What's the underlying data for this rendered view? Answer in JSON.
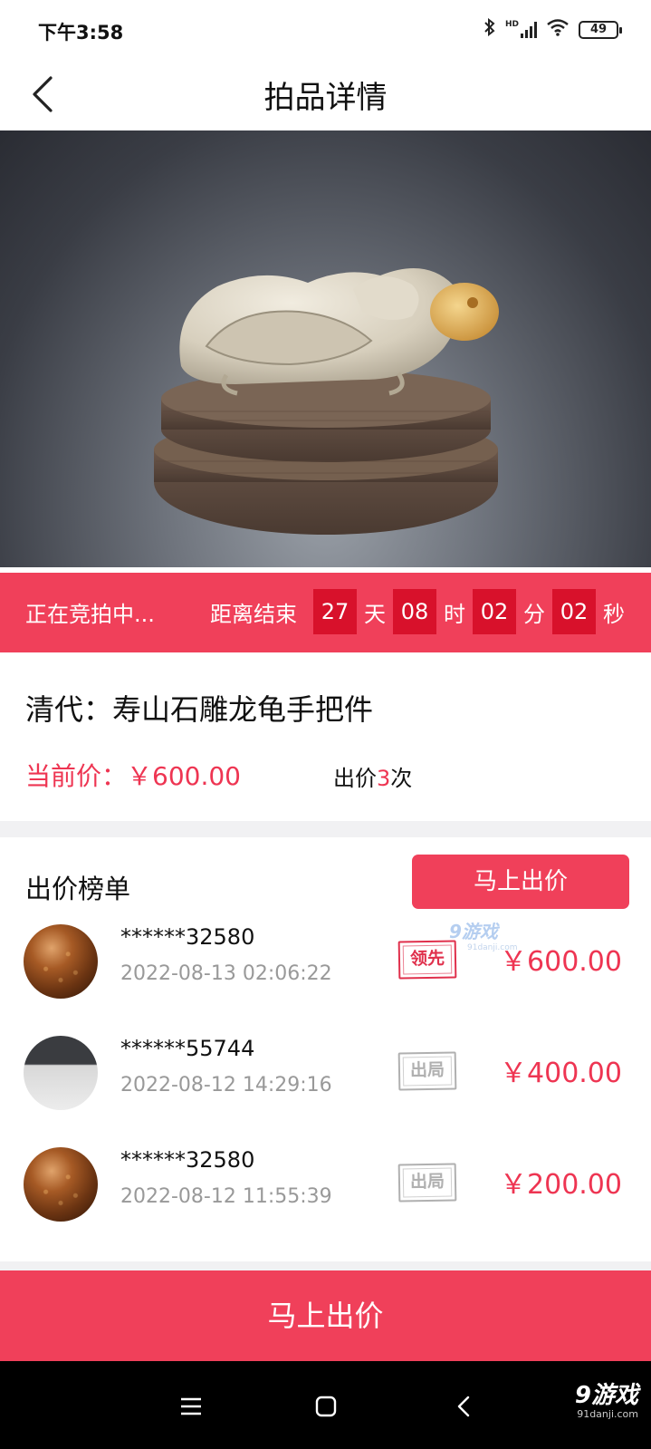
{
  "status_bar": {
    "time": "下午3:58",
    "hd_label": "HD",
    "battery": "49"
  },
  "nav": {
    "title": "拍品详情"
  },
  "carousel": {
    "dots": 4,
    "active_index": 0
  },
  "auction": {
    "status": "正在竞拍中...",
    "countdown_label": "距离结束",
    "days": "27",
    "days_unit": "天",
    "hours": "08",
    "hours_unit": "时",
    "minutes": "02",
    "minutes_unit": "分",
    "seconds": "02",
    "seconds_unit": "秒"
  },
  "lot": {
    "title": "清代：寿山石雕龙龟手把件",
    "current_price": "当前价：￥600.00",
    "bid_count_prefix": "出价",
    "bid_count": "3",
    "bid_count_suffix": "次"
  },
  "leaderboard": {
    "title": "出价榜单",
    "bid_button": "马上出价",
    "watermark": "9游戏",
    "watermark_url": "91danji.com",
    "rows": [
      {
        "bidder": "******32580",
        "time": "2022-08-13 02:06:22",
        "badge": "领先",
        "price": "￥600.00",
        "avatar": "bead-avatar"
      },
      {
        "bidder": "******55744",
        "time": "2022-08-12 14:29:16",
        "badge": "出局",
        "price": "￥400.00",
        "avatar": "laptop-avatar"
      },
      {
        "bidder": "******32580",
        "time": "2022-08-12 11:55:39",
        "badge": "出局",
        "price": "￥200.00",
        "avatar": "bead-avatar"
      }
    ]
  },
  "bottom_button": "马上出价",
  "footer_watermark": {
    "text": "9游戏",
    "url": "91danji.com"
  },
  "colors": {
    "accent": "#f0405a",
    "countdown_box": "#d8112b",
    "price": "#ee3552"
  }
}
